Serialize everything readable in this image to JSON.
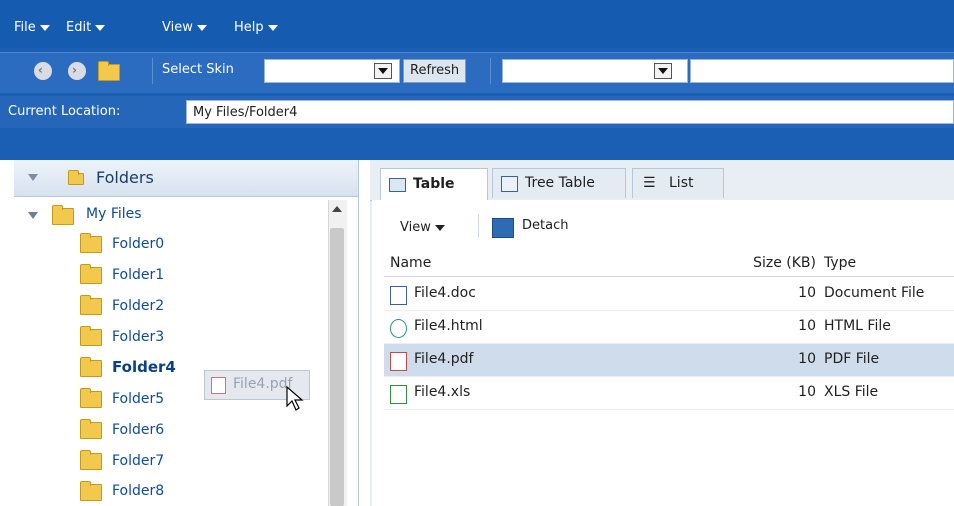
{
  "menu": [
    {
      "label": "File"
    },
    {
      "label": "Edit"
    },
    {
      "label": "View"
    },
    {
      "label": "Help"
    }
  ],
  "toolbar": {
    "select_skin_label": "Select Skin",
    "refresh_label": "Refresh"
  },
  "location": {
    "label": "Current Location:",
    "value": "My Files/Folder4"
  },
  "tree": {
    "header": "Folders",
    "root": "My Files",
    "folders": [
      "Folder0",
      "Folder1",
      "Folder2",
      "Folder3",
      "Folder4",
      "Folder5",
      "Folder6",
      "Folder7",
      "Folder8"
    ],
    "selected_folder": "Folder4",
    "drag_item": "File4.pdf"
  },
  "tabs": [
    {
      "label": "Table"
    },
    {
      "label": "Tree Table"
    },
    {
      "label": "List"
    }
  ],
  "subtoolbar": {
    "view_label": "View",
    "detach_label": "Detach"
  },
  "table": {
    "columns": [
      "Name",
      "Size (KB)",
      "Type"
    ],
    "rows": [
      {
        "name": "File4.doc",
        "size": "10",
        "type": "Document File"
      },
      {
        "name": "File4.html",
        "size": "10",
        "type": "HTML File"
      },
      {
        "name": "File4.pdf",
        "size": "10",
        "type": "PDF File"
      },
      {
        "name": "File4.xls",
        "size": "10",
        "type": "XLS File"
      }
    ],
    "selected_row": "File4.pdf"
  },
  "colors": {
    "chrome_blue": "#1a5fb4",
    "link_blue": "#0f4a9a",
    "selection": "#cfdcec"
  }
}
